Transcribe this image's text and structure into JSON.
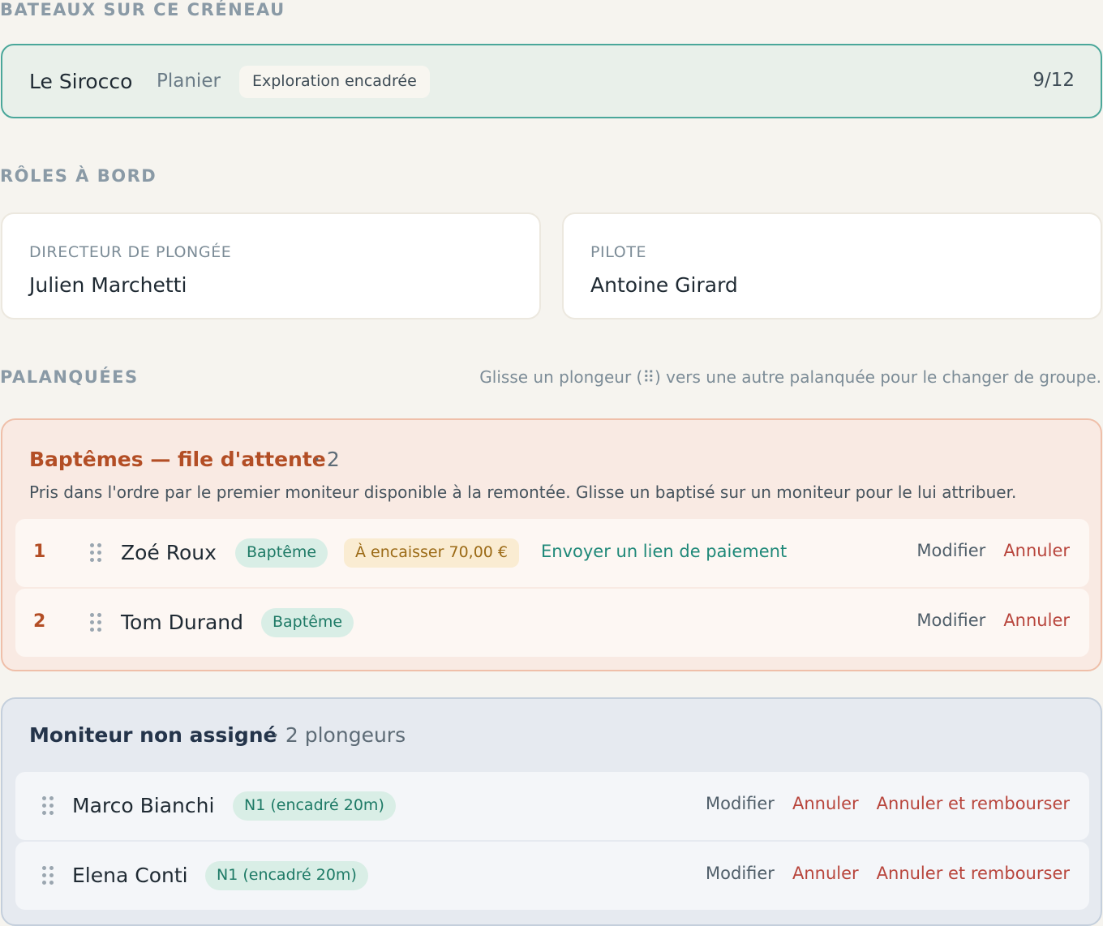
{
  "boats_section": {
    "title": "BATEAUX SUR CE CRÉNEAU",
    "boat": {
      "name": "Le Sirocco",
      "site": "Planier",
      "activity": "Exploration encadrée",
      "occupancy": "9/12"
    }
  },
  "roles_section": {
    "title": "RÔLES À BORD",
    "roles": [
      {
        "label": "DIRECTEUR DE PLONGÉE",
        "value": "Julien Marchetti"
      },
      {
        "label": "PILOTE",
        "value": "Antoine Girard"
      }
    ]
  },
  "palanquees_section": {
    "title": "PALANQUÉES",
    "hint": "Glisse un plongeur (⠿) vers une autre palanquée pour le changer de groupe."
  },
  "bapteme_group": {
    "title": "Baptêmes — file d'attente",
    "count": "· 2",
    "description": "Pris dans l'ordre par le premier moniteur disponible à la remontée. Glisse un baptisé sur un moniteur pour le lui attribuer.",
    "rows": [
      {
        "index": "1",
        "name": "Zoé Roux",
        "level": "Baptême",
        "payment": "À encaisser 70,00 €",
        "payment_link": "Envoyer un lien de paiement",
        "edit": "Modifier",
        "cancel": "Annuler"
      },
      {
        "index": "2",
        "name": "Tom Durand",
        "level": "Baptême",
        "edit": "Modifier",
        "cancel": "Annuler"
      }
    ]
  },
  "moniteur_group": {
    "title": "Moniteur non assigné",
    "count": "· 2 plongeurs",
    "rows": [
      {
        "name": "Marco Bianchi",
        "level": "N1 (encadré 20m)",
        "edit": "Modifier",
        "cancel": "Annuler",
        "refund": "Annuler et rembourser"
      },
      {
        "name": "Elena Conti",
        "level": "N1 (encadré 20m)",
        "edit": "Modifier",
        "cancel": "Annuler",
        "refund": "Annuler et rembourser"
      }
    ]
  },
  "colors": {
    "accent_teal": "#4aa79a",
    "bapteme_title": "#b34e25",
    "cancel_red": "#b8453c",
    "link_teal": "#1e8878"
  }
}
